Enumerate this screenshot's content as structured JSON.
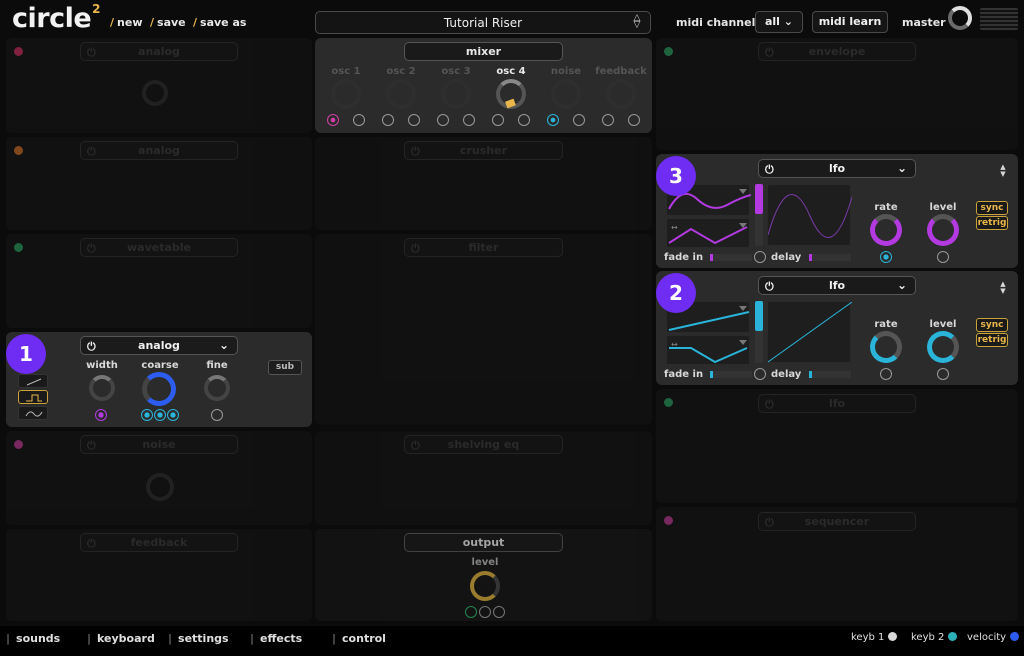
{
  "app": {
    "name": "circle",
    "superscript": "2"
  },
  "top_links": [
    "new",
    "save",
    "save as"
  ],
  "preset": {
    "name": "Tutorial Riser"
  },
  "midi": {
    "channel_label": "midi channel",
    "channel_value": "all",
    "learn_label": "midi learn"
  },
  "master": {
    "label": "master"
  },
  "mixer": {
    "title": "mixer",
    "channels": [
      "osc 1",
      "osc 2",
      "osc 3",
      "osc 4",
      "noise",
      "feedback"
    ]
  },
  "left_modules": [
    {
      "type": "analog",
      "color": "#e0336a"
    },
    {
      "type": "analog",
      "color": "#e07a2a"
    },
    {
      "type": "wavetable",
      "color": "#2fae6b"
    },
    {
      "type": "analog",
      "color": "#d13fa4"
    },
    {
      "type": "noise",
      "color": "#d13fa4"
    },
    {
      "type": "feedback"
    }
  ],
  "active_osc": {
    "badge": "1",
    "type": "analog",
    "controls": [
      "width",
      "coarse",
      "fine"
    ],
    "sub_label": "sub"
  },
  "middle_modules": [
    "crusher",
    "filter",
    "shelving eq"
  ],
  "output": {
    "title": "output",
    "level_label": "level"
  },
  "right_modules": [
    "envelope",
    "lfo",
    "sequencer"
  ],
  "lfo3": {
    "badge": "3",
    "type": "lfo",
    "rate_label": "rate",
    "level_label": "level",
    "sync_label": "sync",
    "retrig_label": "retrig",
    "fade_label": "fade in",
    "delay_label": "delay",
    "color": "#b23ae0"
  },
  "lfo2": {
    "badge": "2",
    "type": "lfo",
    "rate_label": "rate",
    "level_label": "level",
    "sync_label": "sync",
    "retrig_label": "retrig",
    "fade_label": "fade in",
    "delay_label": "delay",
    "color": "#2ab4d9"
  },
  "bottom_nav": [
    "sounds",
    "keyboard",
    "settings",
    "effects",
    "control"
  ],
  "legend": [
    {
      "label": "keyb 1",
      "color": "#d8d8d8"
    },
    {
      "label": "keyb 2",
      "color": "#2bb0b8"
    },
    {
      "label": "velocity",
      "color": "#2c5df0"
    }
  ]
}
